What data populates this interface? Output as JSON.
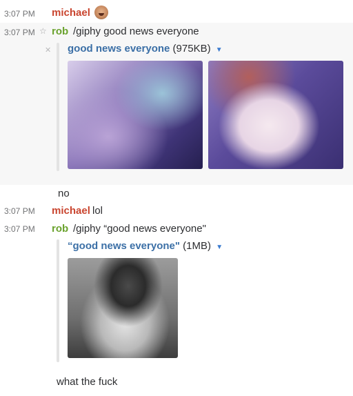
{
  "messages": [
    {
      "time": "3:07 PM",
      "user": "michael",
      "avatar": "angry-face-avatar"
    },
    {
      "time": "3:07 PM",
      "user": "rob",
      "text": "/giphy good news everyone",
      "attachment": {
        "title": "good news everyone",
        "size": "(975KB)",
        "images": [
          "anime-gif-frame",
          "anime-gif-frame"
        ]
      }
    },
    {
      "text": "no"
    },
    {
      "time": "3:07 PM",
      "user": "michael",
      "text": "lol"
    },
    {
      "time": "3:07 PM",
      "user": "rob",
      "text": "/giphy “good news everyone\"",
      "attachment": {
        "title": "“good news everyone\"",
        "size": "(1MB)",
        "images": [
          "grayscale-photo-gif"
        ]
      }
    },
    {
      "text": "what the fuck"
    }
  ],
  "icons": {
    "star": "star-icon",
    "dropdown": "caret-down-icon",
    "close": "close-icon"
  },
  "colors": {
    "michael": "#c9452f",
    "rob": "#6aa22d",
    "link": "#3b6fa6",
    "highlight": "#f7f7f7"
  }
}
